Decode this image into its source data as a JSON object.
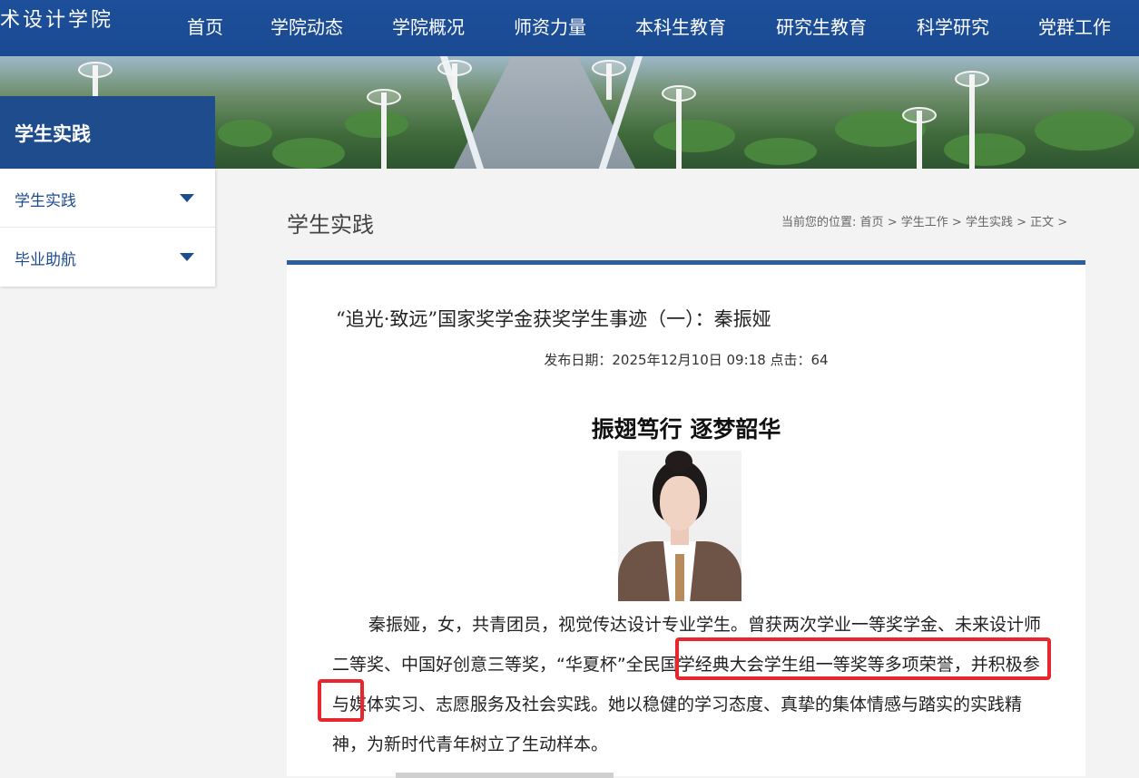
{
  "site": {
    "logo_text": "术设计学院"
  },
  "nav": {
    "items": [
      "首页",
      "学院动态",
      "学院概况",
      "师资力量",
      "本科生教育",
      "研究生教育",
      "科学研究",
      "党群工作"
    ]
  },
  "sidebar": {
    "header": "学生实践",
    "items": [
      {
        "label": "学生实践"
      },
      {
        "label": "毕业助航"
      }
    ]
  },
  "main": {
    "section_title": "学生实践",
    "breadcrumb": {
      "prefix": "当前您的位置:",
      "items": [
        "首页",
        "学生工作",
        "学生实践",
        "正文"
      ],
      "separator": ">"
    },
    "article": {
      "title": "“追光·致远”国家奖学金获奖学生事迹（一）：秦振娅",
      "meta": "发布日期：2025年12月10日 09:18  点击：64",
      "subtitle": "振翅笃行 逐梦韶华",
      "paragraph": "秦振娅，女，共青团员，视觉传达设计专业学生。曾获两次学业一等奖学金、未来设计师二等奖、中国好创意三等奖，“华夏杯”全民国学经典大会学生组一等奖等多项荣誉，并积极参与媒体实习、志愿服务及社会实践。她以稳健的学习态度、真挚的集体情感与踏实的实践精神，为新时代青年树立了生动样本。"
    }
  },
  "colors": {
    "nav_bg": "#1d4f9a",
    "sidebar_accent": "#1f4c8d",
    "rule": "#2d5ea0",
    "highlight_box": "#e8262d"
  },
  "icons": {
    "sidebar_caret": "caret-down-icon"
  }
}
